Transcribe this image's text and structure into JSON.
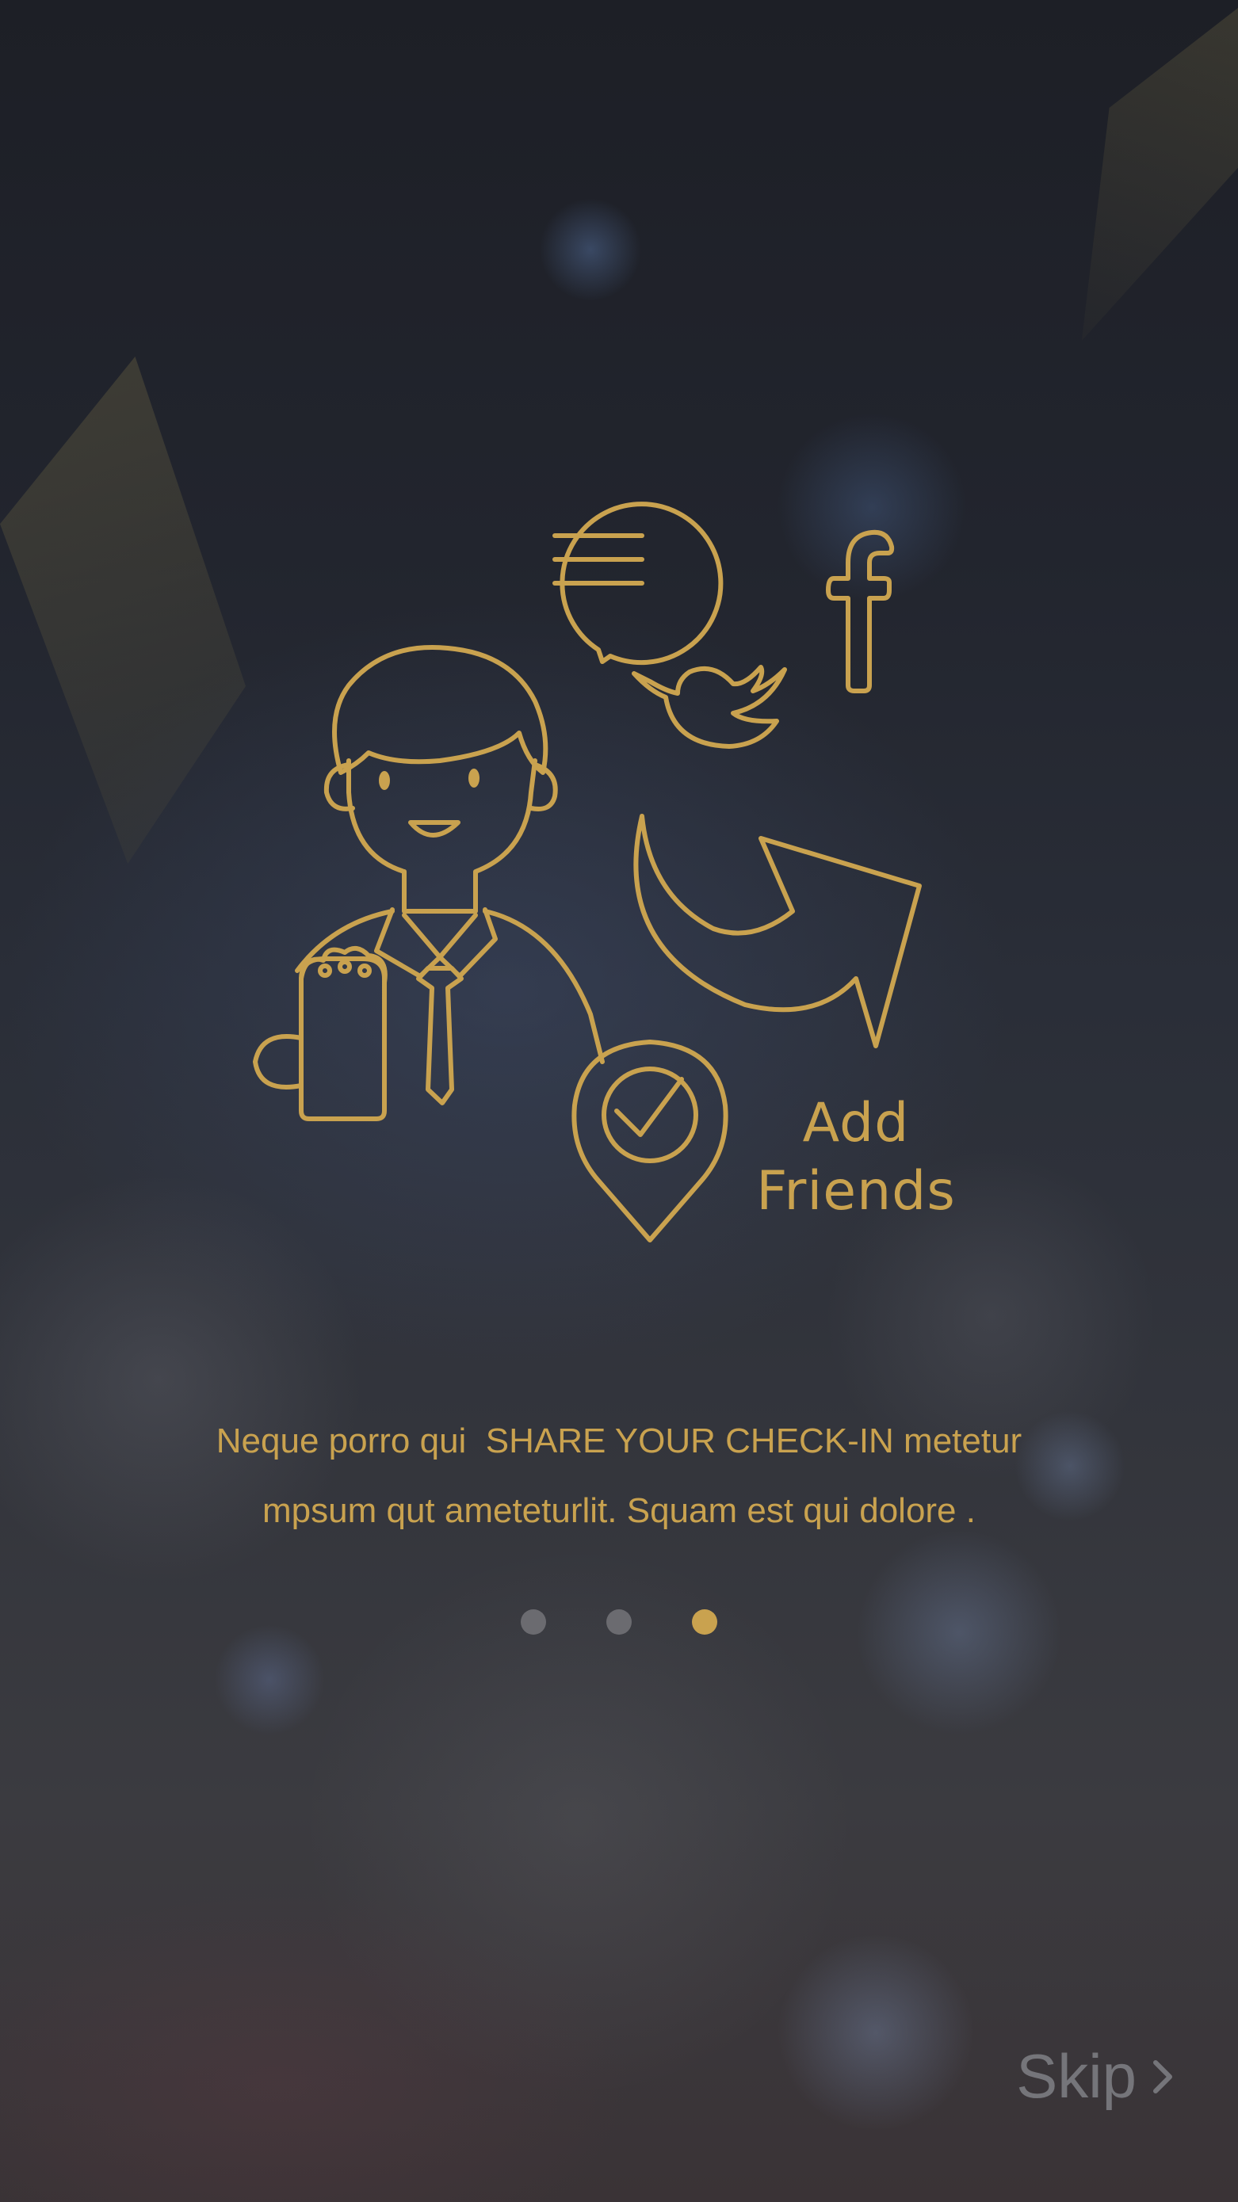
{
  "onboarding": {
    "illustration_label_line1": "Add",
    "illustration_label_line2": "Friends",
    "description_line1": "Neque porro qui  SHARE YOUR CHECK-IN metetur",
    "description_line2": "mpsum qut ameteturlit. Squam est qui dolore .",
    "pager": {
      "total": 3,
      "active_index": 2
    },
    "skip_label": "Skip",
    "icons": [
      "person-with-beer-icon",
      "chat-bubble-icon",
      "twitter-icon",
      "facebook-icon",
      "share-arrow-icon",
      "check-in-pin-icon",
      "chevron-right-icon"
    ]
  },
  "colors": {
    "accent_gold": "#c9a24f",
    "dot_inactive": "#6b6b70",
    "skip_text": "#75757a",
    "background_top": "#1d1f26",
    "background_bottom": "#3a3336"
  }
}
